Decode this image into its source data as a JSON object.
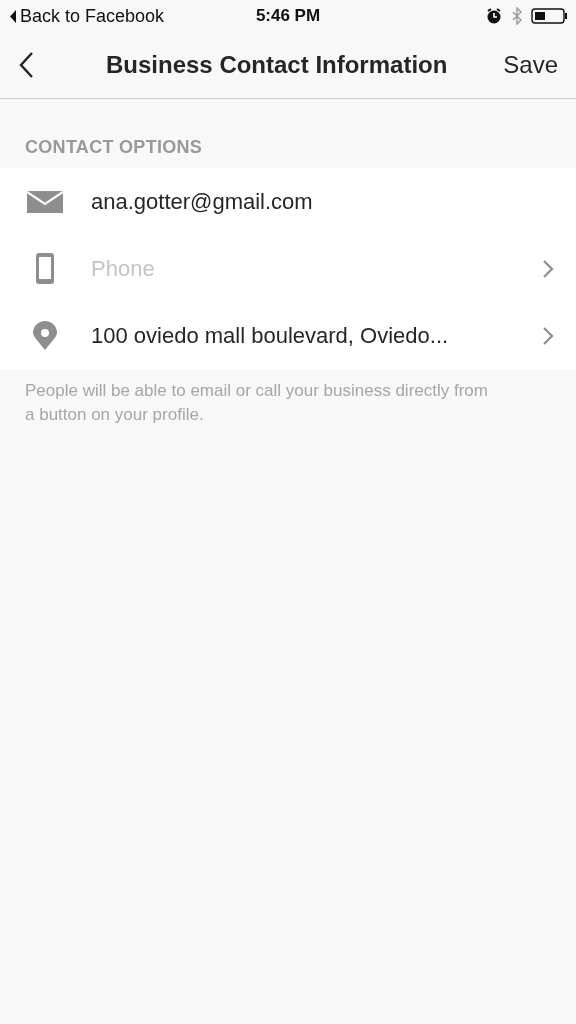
{
  "status_bar": {
    "back_label": "Back to Facebook",
    "time": "5:46 PM"
  },
  "nav": {
    "title": "Business Contact Information",
    "action": "Save"
  },
  "section": {
    "header": "CONTACT OPTIONS",
    "rows": [
      {
        "kind": "email",
        "value": "ana.gotter@gmail.com",
        "chevron": false
      },
      {
        "kind": "phone",
        "placeholder": "Phone",
        "chevron": true
      },
      {
        "kind": "location",
        "value": "100 oviedo mall boulevard, Oviedo...",
        "chevron": true
      }
    ],
    "footnote": "People will be able to email or call your business directly from a button on your profile."
  }
}
